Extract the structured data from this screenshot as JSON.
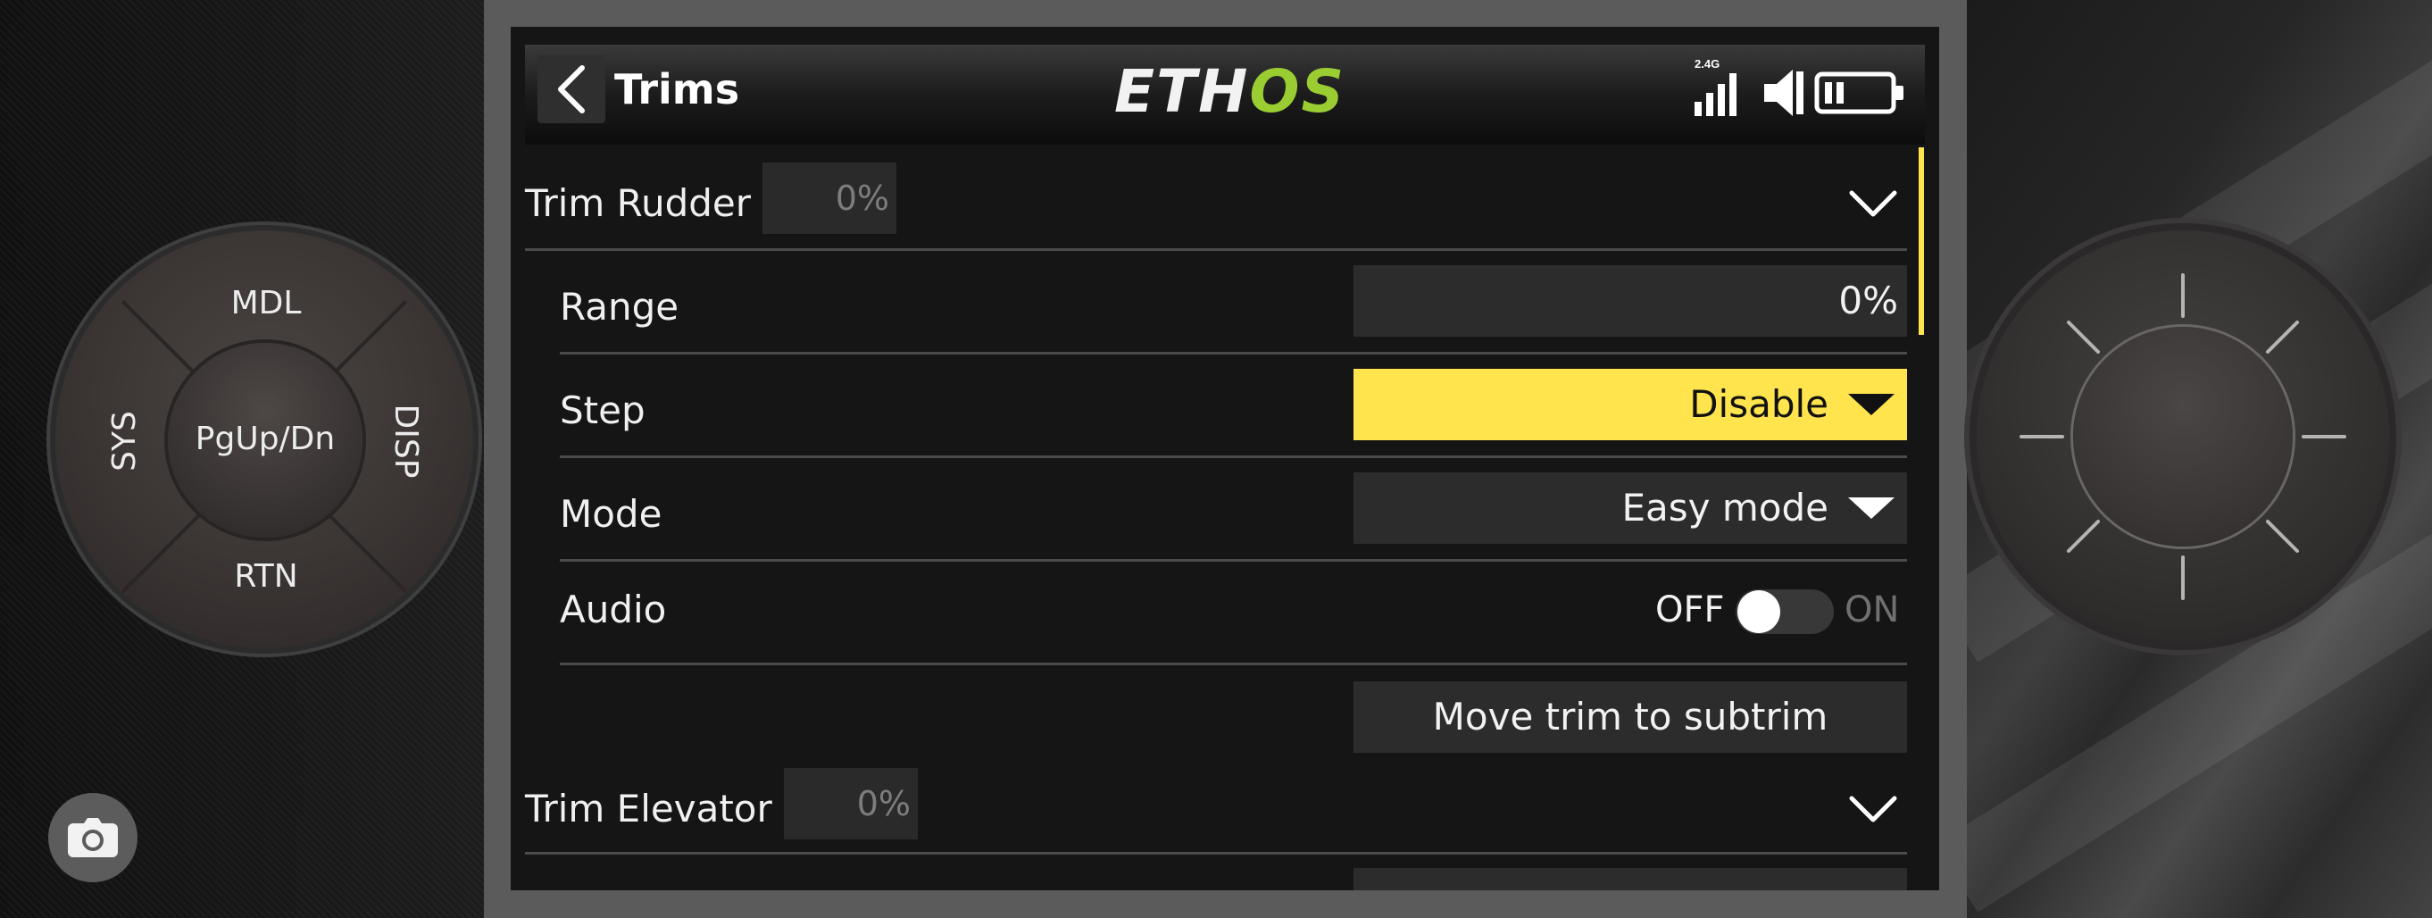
{
  "header": {
    "title": "Trims",
    "logo_part1": "ETH",
    "logo_part2": "OS",
    "rf_band": "2.4G"
  },
  "colors": {
    "accent": "#ffe44d",
    "logo_green": "#9acd32",
    "screen_bg": "#151515",
    "field_bg": "#2c2c2c"
  },
  "sections": {
    "rudder": {
      "label": "Trim Rudder",
      "value": "0%",
      "range_label": "Range",
      "range_value": "0%",
      "step_label": "Step",
      "step_value": "Disable",
      "mode_label": "Mode",
      "mode_value": "Easy mode",
      "audio_label": "Audio",
      "audio_off": "OFF",
      "audio_on": "ON",
      "audio_state": "off",
      "subtrim_button": "Move trim to subtrim"
    },
    "elevator": {
      "label": "Trim Elevator",
      "value": "0%"
    }
  },
  "dpad": {
    "top": "MDL",
    "bottom": "RTN",
    "left": "SYS",
    "right": "DISP",
    "center": "PgUp/Dn"
  },
  "icons": {
    "back": "back-chevron-icon",
    "signal": "signal-bars-icon",
    "speaker": "speaker-icon",
    "battery": "battery-icon",
    "expand": "chevron-down-icon",
    "dropdown": "triangle-down-icon",
    "camera": "camera-icon"
  }
}
